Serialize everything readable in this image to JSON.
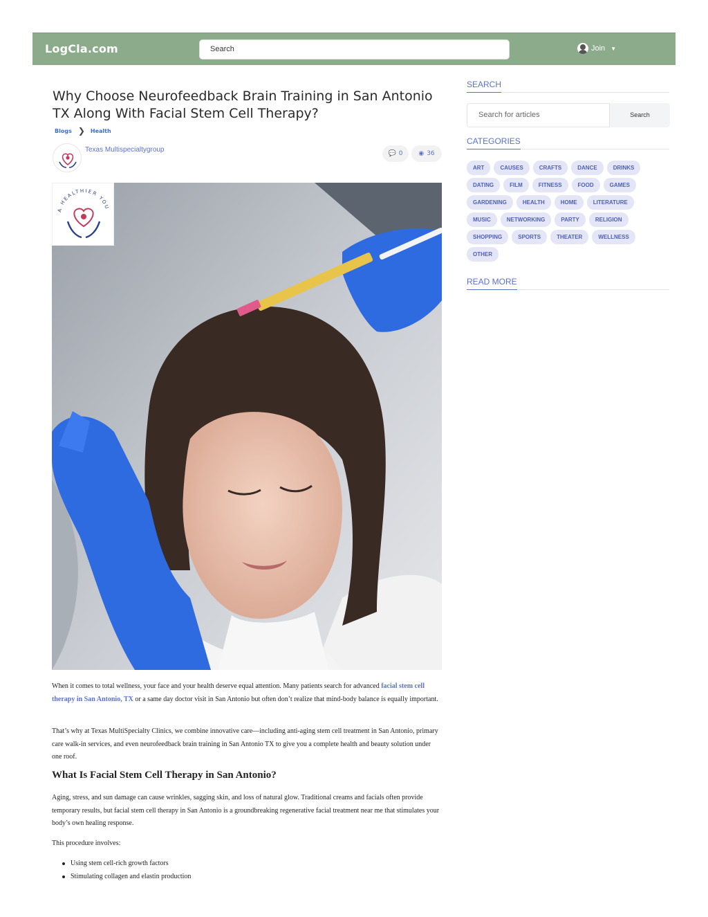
{
  "header": {
    "logo": "LogCla.com",
    "search_label": "Search",
    "join_label": "Join"
  },
  "article": {
    "title": "Why Choose Neurofeedback Brain Training in San Antonio TX Along With Facial Stem Cell Therapy?",
    "breadcrumb": [
      "Blogs",
      "Health"
    ],
    "author": "Texas Multispecialtygroup",
    "comments": "0",
    "views": "36",
    "logo_text": "A HEALTHIER YOU",
    "p1_before": "When it comes to total wellness, your face and your health deserve equal attention. Many patients search for advanced ",
    "p1_link": "facial stem cell therapy in San Antonio, TX",
    "p1_after": " or a same day doctor visit in San Antonio but often don’t realize that mind-body balance is equally important.",
    "p2": "That’s why at Texas MultiSpecialty Clinics, we combine innovative care—including anti-aging stem cell treatment in San Antonio, primary care walk-in services, and even neurofeedback brain training in San Antonio TX to give you a complete health and beauty solution under one roof.",
    "h2": "What Is Facial Stem Cell Therapy in San Antonio?",
    "p3": "Aging, stress, and sun damage can cause wrinkles, sagging skin, and loss of natural glow. Traditional creams and facials often provide temporary results, but facial stem cell therapy in San Antonio is a groundbreaking regenerative facial treatment near me that stimulates your body’s own healing response.",
    "p4": "This procedure involves:",
    "list": [
      "Using stem cell-rich growth factors",
      "Stimulating collagen and elastin production"
    ]
  },
  "sidebar": {
    "search_heading": "SEARCH",
    "search_placeholder": "Search for articles",
    "search_button": "Search",
    "categories_heading": "CATEGORIES",
    "categories": [
      "ART",
      "CAUSES",
      "CRAFTS",
      "DANCE",
      "DRINKS",
      "DATING",
      "FILM",
      "FITNESS",
      "FOOD",
      "GAMES",
      "GARDENING",
      "HEALTH",
      "HOME",
      "LITERATURE",
      "MUSIC",
      "NETWORKING",
      "PARTY",
      "RELIGION",
      "SHOPPING",
      "SPORTS",
      "THEATER",
      "WELLNESS",
      "OTHER"
    ],
    "read_more_heading": "READ MORE"
  },
  "colors": {
    "header_bg": "#8bab8b",
    "accent": "#5b72c9",
    "tag_bg": "#e4e6f7"
  }
}
